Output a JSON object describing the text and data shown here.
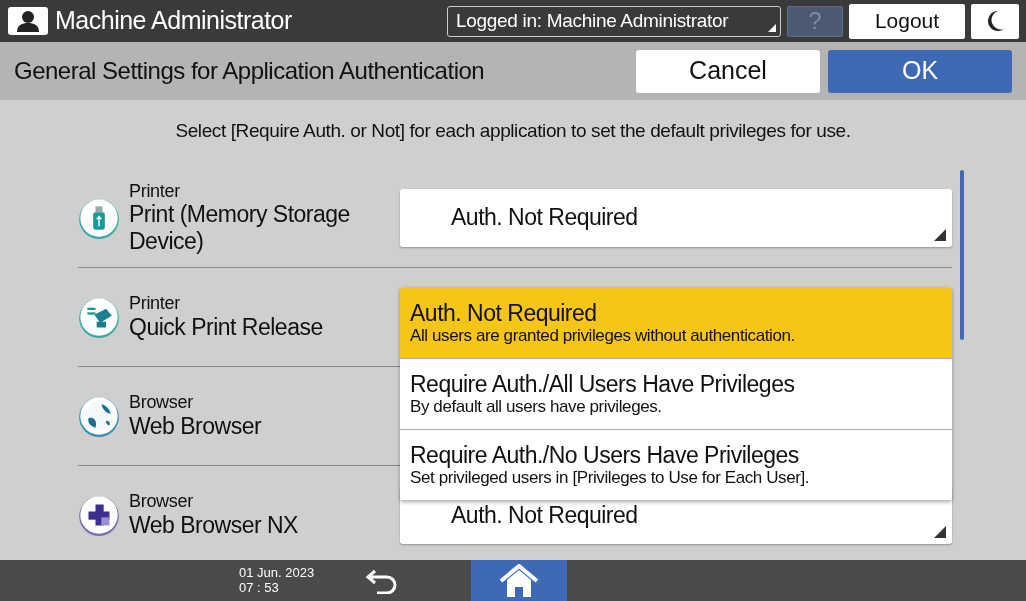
{
  "header": {
    "user_name": "Machine Administrator",
    "login_status": "Logged in: Machine Administrator",
    "help": "?",
    "logout": "Logout"
  },
  "title_bar": {
    "title": "General Settings for Application Authentication",
    "cancel": "Cancel",
    "ok": "OK"
  },
  "instruction": "Select [Require Auth. or Not] for each application to set the default privileges for use.",
  "applications": [
    {
      "kind": "usb",
      "category": "Printer",
      "name": "Print (Memory Storage Device)",
      "value": "Auth. Not Required"
    },
    {
      "kind": "release",
      "category": "Printer",
      "name": "Quick Print Release"
    },
    {
      "kind": "globe",
      "category": "Browser",
      "name": "Web Browser"
    },
    {
      "kind": "plus",
      "category": "Browser",
      "name": "Web Browser NX",
      "value": "Auth. Not Required"
    }
  ],
  "dropdown_options": [
    {
      "title": "Auth. Not Required",
      "description": "All users are granted privileges without authentication.",
      "selected": true
    },
    {
      "title": "Require Auth./All Users Have Privileges",
      "description": "By default all users have privileges.",
      "selected": false
    },
    {
      "title": "Require Auth./No Users Have Privileges",
      "description": "Set privileged users in [Privileges to Use for Each User].",
      "selected": false
    }
  ],
  "footer": {
    "date": "01 Jun. 2023",
    "time": "07 : 53"
  }
}
